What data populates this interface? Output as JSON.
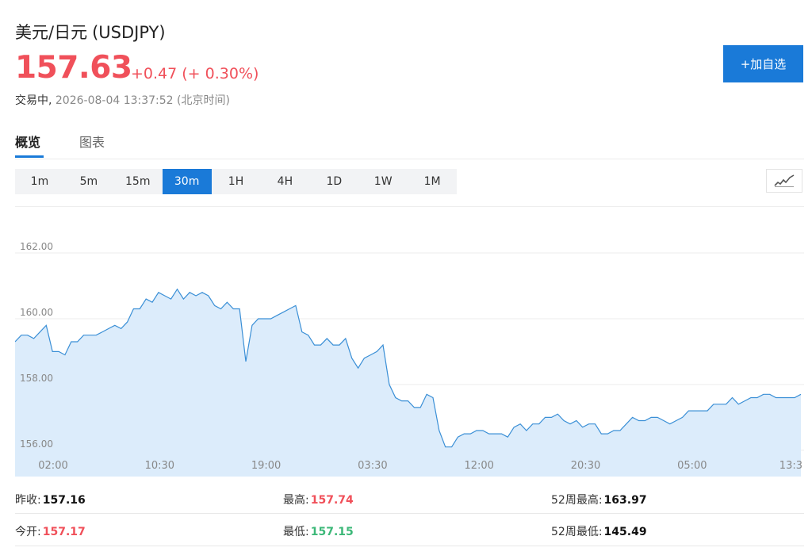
{
  "header": {
    "name": "美元/日元",
    "symbol": "(USDJPY)",
    "price": "157.63",
    "change": "+0.47 (+ 0.30%)",
    "status": "交易中,",
    "datetime": " 2026-08-04 13:37:52 (北京时间)",
    "add_button": "+加自选"
  },
  "tabs": [
    {
      "label": "概览",
      "active": true
    },
    {
      "label": "图表",
      "active": false
    }
  ],
  "periods": [
    "1m",
    "5m",
    "15m",
    "30m",
    "1H",
    "4H",
    "1D",
    "1W",
    "1M"
  ],
  "active_period": "30m",
  "colors": {
    "up": "#f0505a",
    "down": "#3cb878",
    "accent": "#1a7ad8",
    "line": "#3a8fd6",
    "area": "#dcecfb"
  },
  "icons": {
    "chart_type": "line-chart-icon"
  },
  "chart_data": {
    "type": "area",
    "xlabels": [
      "02:00",
      "10:30",
      "19:00",
      "03:30",
      "12:00",
      "20:30",
      "05:00",
      "13:3"
    ],
    "ylabels": [
      "162.00",
      "160.00",
      "158.00",
      "156.00"
    ],
    "ylim": [
      155.2,
      163.4
    ],
    "grid": true,
    "values": [
      159.3,
      159.5,
      159.5,
      159.4,
      159.6,
      159.8,
      159.0,
      159.0,
      158.9,
      159.3,
      159.3,
      159.5,
      159.5,
      159.5,
      159.6,
      159.7,
      159.8,
      159.7,
      159.9,
      160.3,
      160.3,
      160.6,
      160.5,
      160.8,
      160.7,
      160.6,
      160.9,
      160.6,
      160.8,
      160.7,
      160.8,
      160.7,
      160.4,
      160.3,
      160.5,
      160.3,
      160.3,
      158.7,
      159.8,
      160.0,
      160.0,
      160.0,
      160.1,
      160.2,
      160.3,
      160.4,
      159.6,
      159.5,
      159.2,
      159.2,
      159.4,
      159.2,
      159.2,
      159.4,
      158.8,
      158.5,
      158.8,
      158.9,
      159.0,
      159.2,
      158.0,
      157.6,
      157.5,
      157.5,
      157.3,
      157.3,
      157.7,
      157.6,
      156.6,
      156.1,
      156.1,
      156.4,
      156.5,
      156.5,
      156.6,
      156.6,
      156.5,
      156.5,
      156.5,
      156.4,
      156.7,
      156.8,
      156.6,
      156.8,
      156.8,
      157.0,
      157.0,
      157.1,
      156.9,
      156.8,
      156.9,
      156.7,
      156.8,
      156.8,
      156.5,
      156.5,
      156.6,
      156.6,
      156.8,
      157.0,
      156.9,
      156.9,
      157.0,
      157.0,
      156.9,
      156.8,
      156.9,
      157.0,
      157.2,
      157.2,
      157.2,
      157.2,
      157.4,
      157.4,
      157.4,
      157.6,
      157.4,
      157.5,
      157.6,
      157.6,
      157.7,
      157.7,
      157.6,
      157.6,
      157.6,
      157.6,
      157.7
    ]
  },
  "stats": [
    {
      "label": "昨收:",
      "value": "157.16",
      "tone": "neutral"
    },
    {
      "label": "最高:",
      "value": "157.74",
      "tone": "up"
    },
    {
      "label": "52周最高:",
      "value": "163.97",
      "tone": "neutral"
    },
    {
      "label": "今开:",
      "value": "157.17",
      "tone": "up"
    },
    {
      "label": "最低:",
      "value": "157.15",
      "tone": "down"
    },
    {
      "label": "52周最低:",
      "value": "145.49",
      "tone": "neutral"
    }
  ]
}
